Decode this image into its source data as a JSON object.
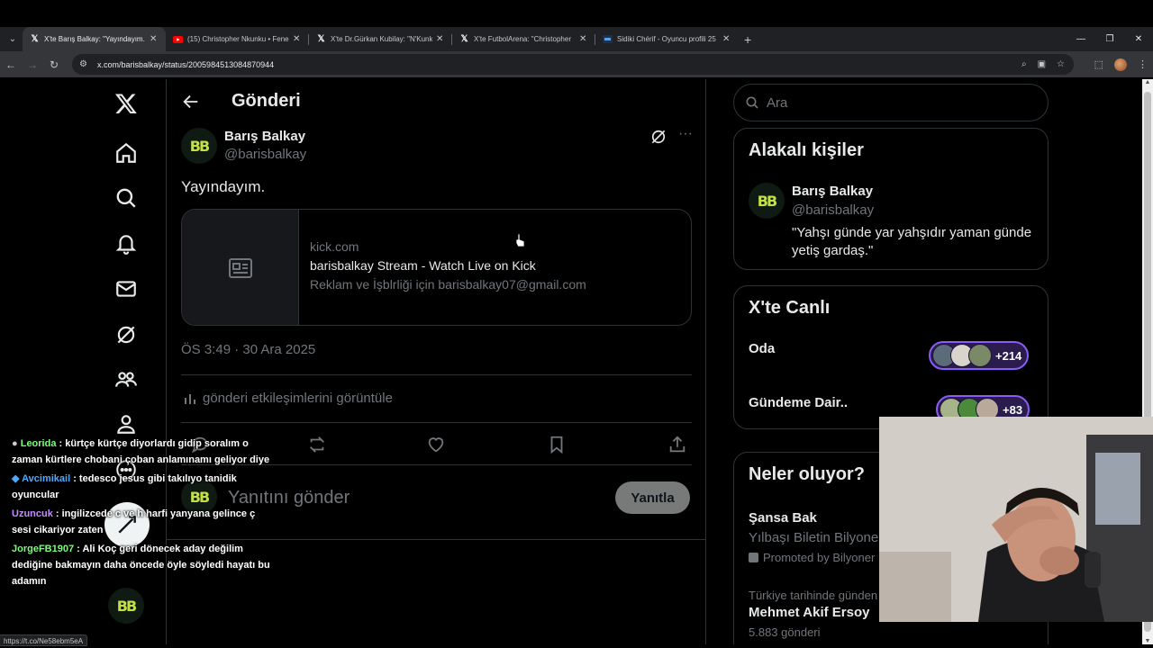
{
  "browser": {
    "tabs": [
      {
        "title": "X'te Barış Balkay: \"Yayındayım.",
        "favicon": "x-logo",
        "active": true
      },
      {
        "title": "(15) Christopher Nkunku • Fene",
        "favicon": "youtube-logo",
        "active": false
      },
      {
        "title": "X'te Dr.Gürkan Kubilay: \"N'Kunk",
        "favicon": "x-logo",
        "active": false
      },
      {
        "title": "X'te FutbolArena: \"Christopher",
        "favicon": "x-logo",
        "active": false
      },
      {
        "title": "Sidiki Chérif - Oyuncu profili 25",
        "favicon": "transfermarkt-logo",
        "active": false
      }
    ],
    "url": "x.com/barisbalkay/status/2005984513084870944",
    "status_url": "https://t.co/Ne58ebm5eA"
  },
  "header": {
    "title": "Gönderi"
  },
  "post": {
    "author_name": "Barış Balkay",
    "author_handle": "@barisbalkay",
    "avatar_text": "BB",
    "text": "Yayındayım.",
    "card": {
      "domain": "kick.com",
      "title": "barisbalkay Stream - Watch Live on Kick",
      "description": "Reklam ve İşblrliği için barisbalkay07@gmail.com"
    },
    "timestamp": "ÖS 3:49 · 30 Ara 2025",
    "engagement_link": "gönderi etkileşimlerini görüntüle"
  },
  "reply": {
    "placeholder": "Yanıtını gönder",
    "button": "Yanıtla"
  },
  "sidebar": {
    "search_placeholder": "Ara",
    "related": {
      "title": "Alakalı kişiler",
      "name": "Barış Balkay",
      "handle": "@barisbalkay",
      "bio": "\"Yahşı günde yar yahşıdır yaman günde yetiş gardaş.\""
    },
    "live": {
      "title": "X'te Canlı",
      "items": [
        {
          "label": "Oda",
          "count": "+214"
        },
        {
          "label": "Gündeme Dair..",
          "count": "+83"
        }
      ]
    },
    "trends": {
      "title": "Neler oluyor?",
      "promo_name": "Şansa Bak",
      "promo_desc": "Yılbaşı Biletin Bilyoner",
      "promo_label": "Promoted by Bilyoner",
      "trend_context": "Türkiye tarihinde günden",
      "trend_name": "Mehmet Akif Ersoy",
      "trend_count": "5.883 gönderi"
    }
  },
  "chat": [
    {
      "user": "Leorida",
      "color": "#7CFC7C",
      "text": "kürtçe kürtçe diyorlardı gidip soralım o zaman kürtlere chobani çoban anlamınamı geliyor diye"
    },
    {
      "user": "Avcimikail",
      "color": "#4FA8FF",
      "text": "tedesco jesus gibi takılıyo tanidik oyuncular"
    },
    {
      "user": "Uzuncuk",
      "color": "#C58CFF",
      "text": "ingilizcede c ve h harfi yanyana gelince ç sesi cikariyor zaten"
    },
    {
      "user": "JorgeFB1907",
      "color": "#7CFC7C",
      "text": "Ali Koç geri dönecek aday değilim dediğine bakmayın daha öncede öyle söyledi hayatı bu adamın"
    }
  ],
  "colors": {
    "accent": "#1d9bf0",
    "live_ring": "#8b5cf6",
    "muted": "#71767b"
  }
}
